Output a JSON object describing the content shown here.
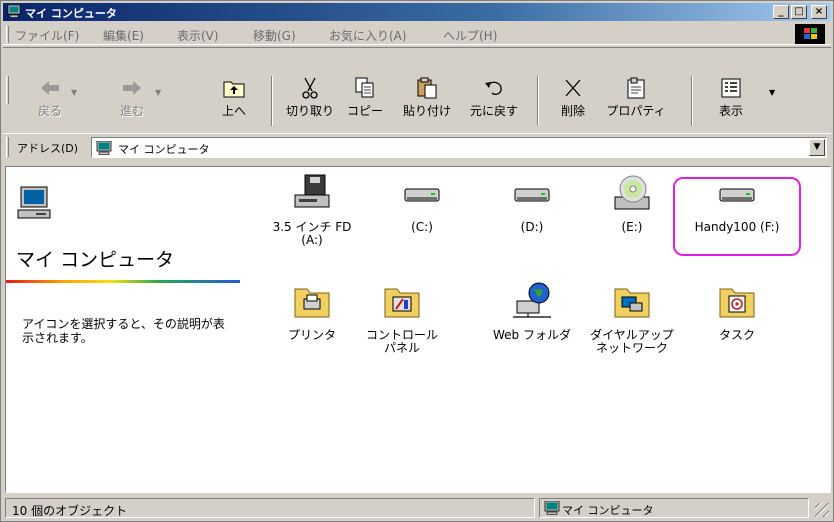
{
  "window": {
    "title": "マイ コンピュータ",
    "controls": {
      "minimize": "_",
      "maximize": "□",
      "close": "×"
    }
  },
  "menu": [
    {
      "label": "ファイル(F)"
    },
    {
      "label": "編集(E)"
    },
    {
      "label": "表示(V)"
    },
    {
      "label": "移動(G)"
    },
    {
      "label": "お気に入り(A)"
    },
    {
      "label": "ヘルプ(H)"
    }
  ],
  "toolbar": {
    "back": "戻る",
    "forward": "進む",
    "up": "上へ",
    "cut": "切り取り",
    "copy": "コピー",
    "paste": "貼り付け",
    "undo": "元に戻す",
    "delete": "削除",
    "properties": "プロパティ",
    "view": "表示"
  },
  "address": {
    "label": "アドレス(D)",
    "value": "マイ コンピュータ"
  },
  "left_pane": {
    "title": "マイ コンピュータ",
    "description": "アイコンを選択すると、その説明が表示されます。"
  },
  "items": [
    {
      "label": "3.5 インチ FD\n(A:)",
      "icon": "floppy-drive-icon"
    },
    {
      "label": "(C:)",
      "icon": "hard-drive-icon"
    },
    {
      "label": "(D:)",
      "icon": "hard-drive-icon"
    },
    {
      "label": "(E:)",
      "icon": "cd-drive-icon"
    },
    {
      "label": "Handy100 (F:)",
      "icon": "hard-drive-icon"
    },
    {
      "label": "プリンタ",
      "icon": "printers-folder-icon"
    },
    {
      "label": "コントロール\nパネル",
      "icon": "control-panel-folder-icon"
    },
    {
      "label": "Web フォルダ",
      "icon": "web-folders-icon"
    },
    {
      "label": "ダイヤルアップ\nネットワーク",
      "icon": "dialup-networking-icon"
    },
    {
      "label": "タスク",
      "icon": "scheduled-tasks-icon"
    }
  ],
  "status": {
    "count": "10 個のオブジェクト",
    "zone": "マイ コンピュータ"
  },
  "colors": {
    "title_start": "#0a246a",
    "title_end": "#a6caf0",
    "face": "#d4d0c8",
    "highlight_border": "#e020e0"
  }
}
